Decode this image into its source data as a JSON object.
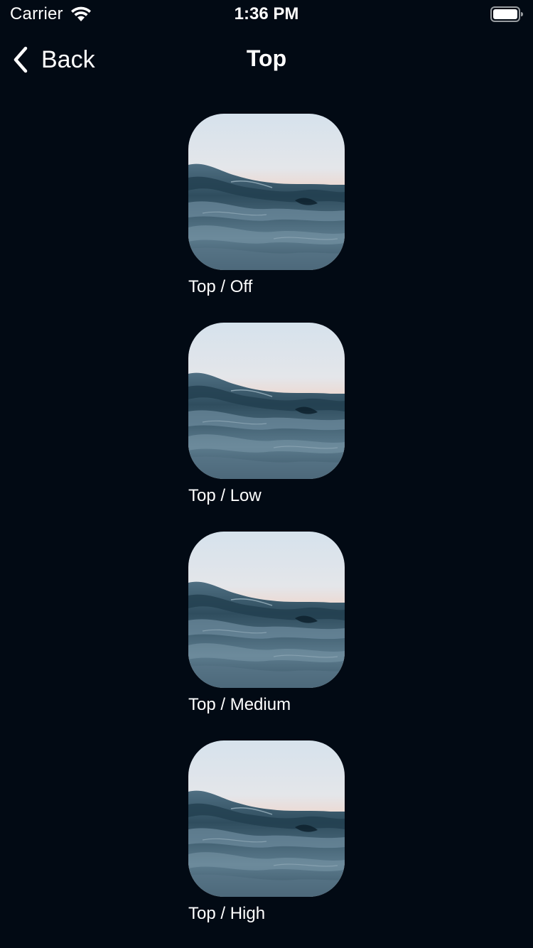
{
  "status_bar": {
    "carrier": "Carrier",
    "time": "1:36 PM",
    "icons": [
      "wifi-icon",
      "battery-icon"
    ]
  },
  "nav": {
    "back_label": "Back",
    "title": "Top",
    "icons": [
      "chevron-left-icon"
    ]
  },
  "items": [
    {
      "label": "Top / Off"
    },
    {
      "label": "Top / Low"
    },
    {
      "label": "Top / Medium"
    },
    {
      "label": "Top / High"
    }
  ],
  "colors": {
    "background": "#020a14",
    "text": "#ffffff",
    "sky_top": "#dfe7ef",
    "sky_horizon": "#eadbd6",
    "sea_light": "#6f8fa3",
    "sea_dark": "#16303f"
  }
}
